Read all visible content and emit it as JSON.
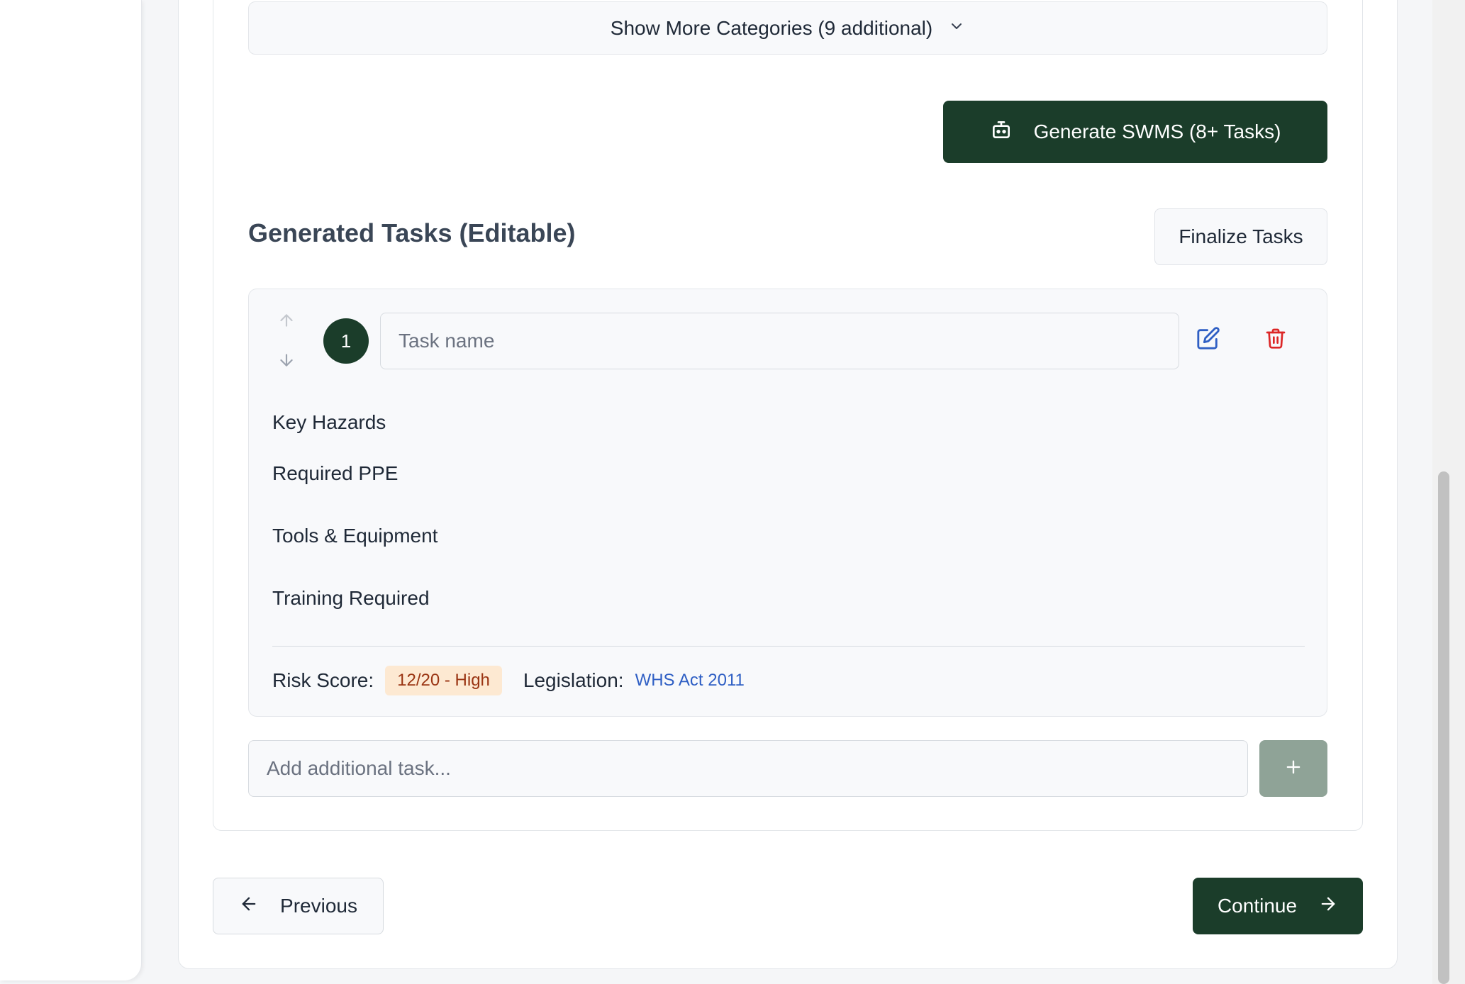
{
  "categories": {
    "show_more_label": "Show More Categories (9 additional)",
    "chevron_icon": "chevron-down-icon"
  },
  "generate": {
    "label": "Generate SWMS (8+ Tasks)",
    "icon": "robot-icon",
    "bg_color": "#1b3d2a"
  },
  "tasks_section": {
    "title": "Generated Tasks (Editable)",
    "finalize_label": "Finalize Tasks"
  },
  "task": {
    "number": "1",
    "name_value": "",
    "name_placeholder": "Task name",
    "fields": {
      "hazards_label": "Key Hazards",
      "ppe_label": "Required PPE",
      "tools_label": "Tools & Equipment",
      "training_label": "Training Required"
    },
    "risk_label": "Risk Score:",
    "risk_value": "12/20 - High",
    "legislation_label": "Legislation:",
    "legislation_value": "WHS Act 2011"
  },
  "add_task": {
    "placeholder": "Add additional task...",
    "value": ""
  },
  "nav": {
    "previous_label": "Previous",
    "continue_label": "Continue"
  },
  "colors": {
    "primary": "#1b3d2a",
    "edit_icon": "#2f5fc4",
    "delete_icon": "#dc2626",
    "risk_badge_bg": "#fde9d2",
    "risk_badge_text": "#9a3412"
  }
}
